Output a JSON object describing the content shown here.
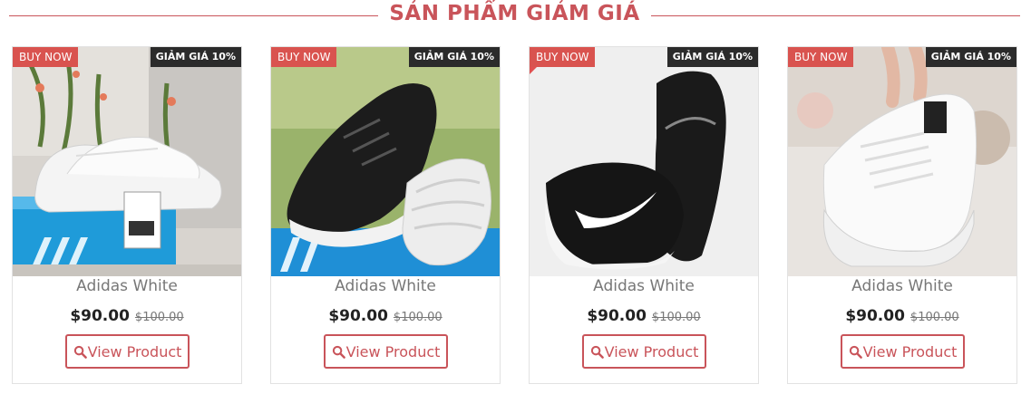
{
  "section": {
    "title": "SẢN PHẨM GIẢM GIÁ"
  },
  "colors": {
    "accent": "#c9545a",
    "badge_buy": "#d9534f",
    "badge_sale": "#2b2b2b"
  },
  "products": [
    {
      "badge_buy": "BUY NOW",
      "badge_sale": "GIẢM GIÁ 10%",
      "name": "Adidas White",
      "price": "$90.00",
      "old_price": "$100.00",
      "button": "View Product",
      "button_icon": "search-icon"
    },
    {
      "badge_buy": "BUY NOW",
      "badge_sale": "GIẢM GIÁ 10%",
      "name": "Adidas White",
      "price": "$90.00",
      "old_price": "$100.00",
      "button": "View Product",
      "button_icon": "search-icon"
    },
    {
      "badge_buy": "BUY NOW",
      "badge_sale": "GIẢM GIÁ 10%",
      "name": "Adidas White",
      "price": "$90.00",
      "old_price": "$100.00",
      "button": "View Product",
      "button_icon": "search-icon"
    },
    {
      "badge_buy": "BUY NOW",
      "badge_sale": "GIẢM GIÁ 10%",
      "name": "Adidas White",
      "price": "$90.00",
      "old_price": "$100.00",
      "button": "View Product",
      "button_icon": "search-icon"
    }
  ]
}
